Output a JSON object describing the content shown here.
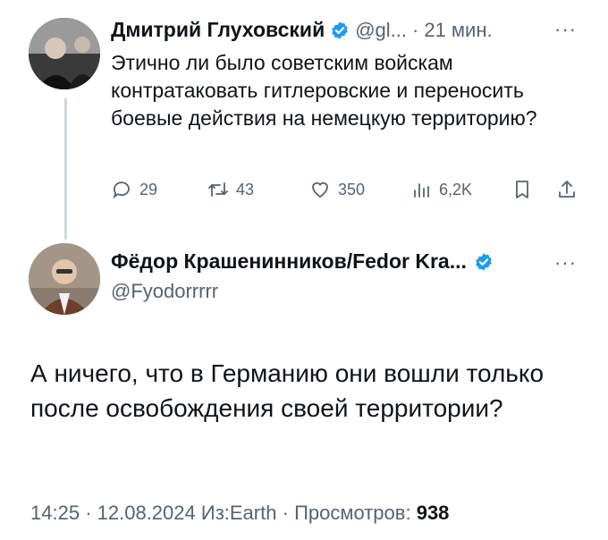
{
  "tweet1": {
    "author_name": "Дмитрий Глуховский",
    "handle": "@gl...",
    "separator": "·",
    "time": "21 мин.",
    "more": "···",
    "text": "Этично ли было советским войскам контратаковать гитлеровские и переносить боевые действия на немецкую территорию?",
    "actions": {
      "replies": "29",
      "retweets": "43",
      "likes": "350",
      "views": "6,2K"
    },
    "icons": [
      "reply-icon",
      "retweet-icon",
      "like-icon",
      "views-icon",
      "bookmark-icon",
      "share-icon"
    ]
  },
  "tweet2": {
    "author_name": "Фёдор Крашенинников/Fedor Kra...",
    "handle": "@Fyodorrrrr",
    "more": "···",
    "text": "А ничего, что в Германию они вошли только после освобождения своей территории?",
    "meta": {
      "time": "14:25",
      "dot1": "·",
      "date": "12.08.2024",
      "source": "Из:Earth",
      "dot2": "·",
      "views_label": "Просмотров:",
      "views_count": "938"
    }
  },
  "colors": {
    "verified": "#1d9bf0",
    "text": "#0f1419",
    "secondary": "#536471",
    "thread_line": "#cfd9de"
  }
}
